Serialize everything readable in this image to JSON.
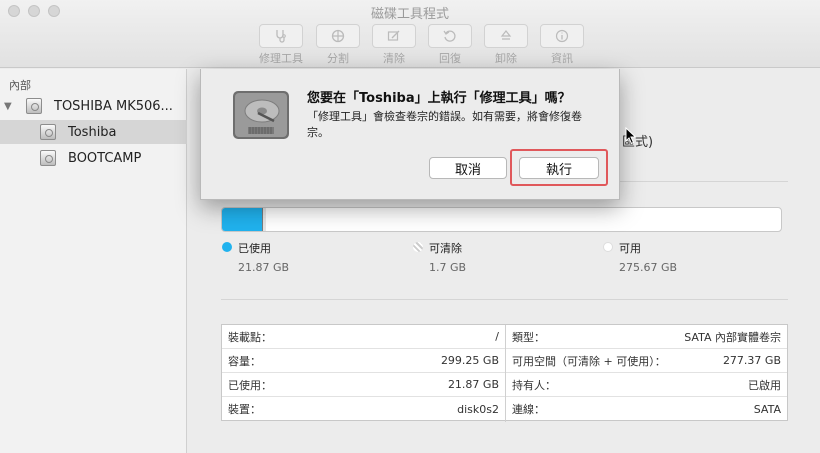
{
  "window": {
    "title": "磁碟工具程式"
  },
  "toolbar": {
    "items": [
      {
        "label": "修理工具",
        "icon": "stethoscope-icon"
      },
      {
        "label": "分割",
        "icon": "partition-icon"
      },
      {
        "label": "清除",
        "icon": "erase-icon"
      },
      {
        "label": "回復",
        "icon": "restore-icon"
      },
      {
        "label": "卸除",
        "icon": "eject-icon"
      },
      {
        "label": "資訊",
        "icon": "info-icon"
      }
    ]
  },
  "sidebar": {
    "section": "內部",
    "items": [
      {
        "label": "TOSHIBA MK506...",
        "kind": "disk",
        "expanded": true
      },
      {
        "label": "Toshiba",
        "kind": "volume",
        "selected": true
      },
      {
        "label": "BOOTCAMP",
        "kind": "volume",
        "selected": false
      }
    ]
  },
  "main": {
    "partial_text": "區式)",
    "usage": {
      "used_fraction": 0.073,
      "purgeable_fraction": 0.006,
      "used_color": "#20b2ee",
      "legend": [
        {
          "label": "已使用",
          "value": "21.87 GB",
          "color": "#20b2ee"
        },
        {
          "label": "可清除",
          "value": "1.7 GB",
          "color": "#d0d0d0"
        },
        {
          "label": "可用",
          "value": "275.67 GB",
          "color": "#ffffff"
        }
      ]
    },
    "info": {
      "left": [
        {
          "key": "裝載點：",
          "value": "/"
        },
        {
          "key": "容量：",
          "value": "299.25 GB"
        },
        {
          "key": "已使用：",
          "value": "21.87 GB"
        },
        {
          "key": "裝置：",
          "value": "disk0s2"
        }
      ],
      "right": [
        {
          "key": "類型：",
          "value": "SATA 內部實體卷宗"
        },
        {
          "key": "可用空間（可清除 + 可使用）：",
          "value": "277.37 GB"
        },
        {
          "key": "持有人：",
          "value": "已啟用"
        },
        {
          "key": "連線：",
          "value": "SATA"
        }
      ]
    }
  },
  "dialog": {
    "title": "您要在「Toshiba」上執行「修理工具」嗎？",
    "message": "「修理工具」會檢查卷宗的錯誤。如有需要，將會修復卷宗。",
    "cancel_label": "取消",
    "run_label": "執行",
    "highlight_color": "#e0585b"
  }
}
